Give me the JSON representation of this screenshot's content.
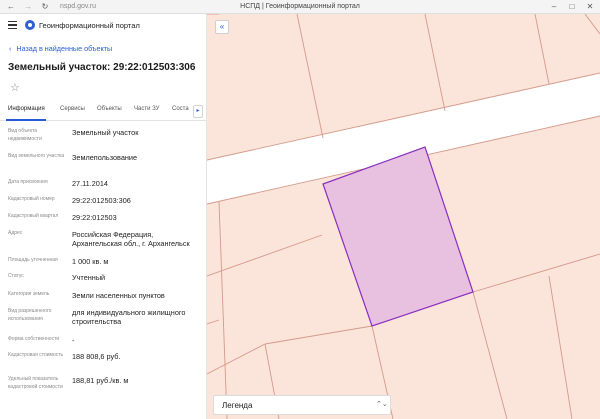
{
  "browser": {
    "back_icon": "back-arrow-icon",
    "forward_icon": "forward-arrow-icon",
    "reload_icon": "reload-icon",
    "url": "nspd.gov.ru",
    "tab_title": "НСПД | Геоинформационный портал"
  },
  "panel": {
    "portal_name": "Геоинформационный портал",
    "back_link": "Назад в найденные объекты",
    "object_title": "Земельный участок: 29:22:012503:306",
    "tabs": [
      "Информация",
      "Сервисы",
      "Объекты",
      "Части ЗУ",
      "Соста"
    ],
    "fields": [
      {
        "label": "Вид объекта недвижимости",
        "value": "Земельный участок"
      },
      {
        "label": "Вид земельного участка",
        "value": "Землепользование"
      },
      {
        "label": "Дата присвоения",
        "value": "27.11.2014"
      },
      {
        "label": "Кадастровый номер",
        "value": "29:22:012503:306"
      },
      {
        "label": "Кадастровый квартал",
        "value": "29:22:012503"
      },
      {
        "label": "Адрес",
        "value": "Российская Федерация, Архангельская обл., г. Архангельск"
      },
      {
        "label": "Площадь уточненная",
        "value": "1 000 кв. м"
      },
      {
        "label": "Статус",
        "value": "Учтенный"
      },
      {
        "label": "Категория земель",
        "value": "Земли населенных пунктов"
      },
      {
        "label": "Вид разрешенного использования",
        "value": "для индивидуального жилищного строительства"
      },
      {
        "label": "Форма собственности",
        "value": "-"
      },
      {
        "label": "Кадастровая стоимость",
        "value": "188 808,6 руб."
      },
      {
        "label": "Удельный показатель кадастровой стоимости",
        "value": "188,81 руб./кв. м"
      }
    ]
  },
  "map": {
    "legend_label": "Легенда",
    "colors": {
      "parcel_fill": "#fbe4d9",
      "parcel_border": "#d49a8a",
      "road": "#ffffff",
      "selected_fill": "#e8c0e0",
      "selected_border": "#8a2fc0"
    }
  }
}
